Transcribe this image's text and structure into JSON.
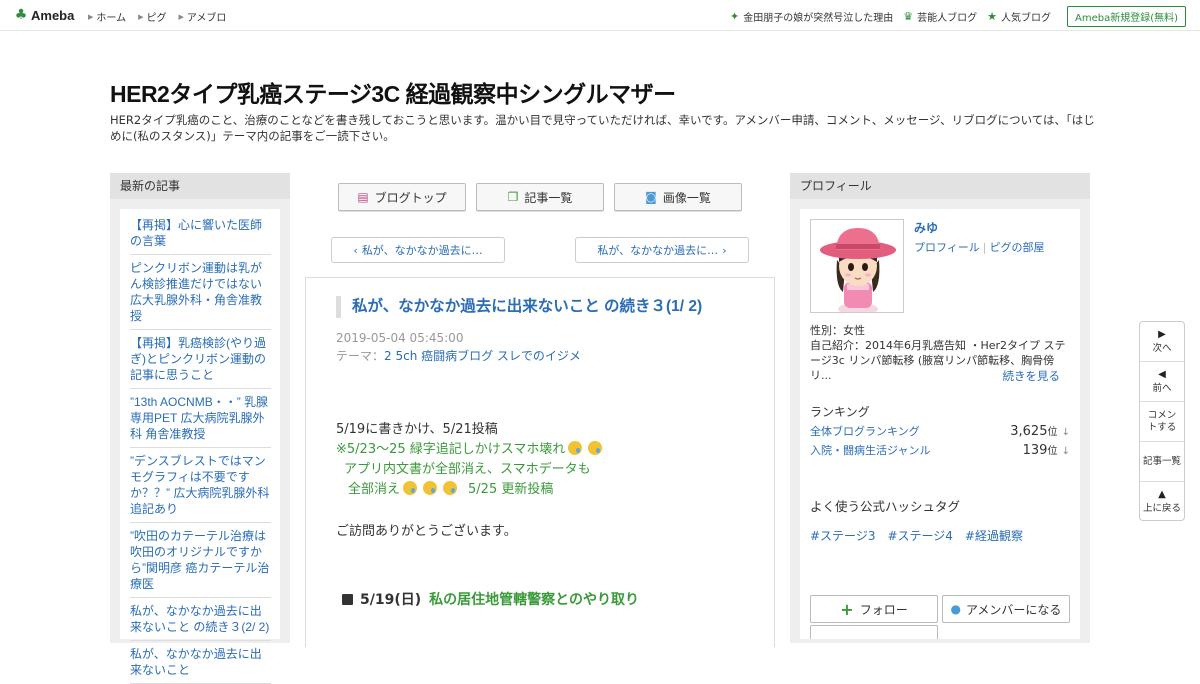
{
  "topbar": {
    "logo_text": "Ameba",
    "nav": [
      "ホーム",
      "ピグ",
      "アメブロ"
    ],
    "right_links": [
      {
        "icon": "sparkle-icon",
        "label": "金田朋子の娘が突然号泣した理由"
      },
      {
        "icon": "crown-icon",
        "label": "芸能人ブログ"
      },
      {
        "icon": "star-icon",
        "label": "人気ブログ"
      }
    ],
    "register_label": "Ameba新規登録(無料)"
  },
  "header": {
    "title": "HER2タイプ乳癌ステージ3C 経過観察中シングルマザー",
    "description": "HER2タイプ乳癌のこと、治療のことなどを書き残しておこうと思います。温かい目で見守っていただければ、幸いです。アメンバー申請、コメント、メッセージ、リブログについては、「はじめに(私のスタンス)」テーマ内の記事をご一読下さい。"
  },
  "left_sidebar": {
    "heading": "最新の記事",
    "items": [
      "【再掲】心に響いた医師の言葉",
      "ピンクリボン運動は乳がん検診推進だけではない 広大乳腺外科・角舎准教授",
      "【再掲】乳癌検診(やり過ぎ)とピンクリボン運動の記事に思うこと",
      "”13th AOCNMB・・” 乳腺専用PET 広大病院乳腺外科 角舎准教授",
      "”デンスブレストではマンモグラフィは不要ですか？？” 広大病院乳腺外科追記あり",
      "”吹田のカテーテル治療は吹田のオリジナルですから”関明彦 癌カテーテル治療医",
      "私が、なかなか過去に出来ないこと の続き３(2/ 2)",
      "私が、なかなか過去に出来ないこと"
    ]
  },
  "center": {
    "tabs": [
      {
        "icon": "document-icon",
        "label": "ブログトップ"
      },
      {
        "icon": "list-icon",
        "label": "記事一覧"
      },
      {
        "icon": "camera-icon",
        "label": "画像一覧"
      }
    ],
    "prev_label": "私が、なかなか過去に…",
    "next_label": "私が、なかなか過去に…",
    "article": {
      "title": "私が、なかなか過去に出来ないこと の続き３(1/ 2)",
      "date": "2019-05-04 05:45:00",
      "theme_prefix": "テーマ：",
      "theme_link": "2 5ch 癌闘病ブログ スレでのイジメ",
      "line1": "5/19に書きかけ、5/21投稿",
      "line2": "※5/23～25 緑字追記しかけスマホ壊れ",
      "line3": "アプリ内文書が全部消え、スマホデータも",
      "line4a": "全部消え",
      "line4b": "5/25 更新投稿",
      "line5": "ご訪問ありがとうございます。",
      "section_date": "5/19(日)",
      "section_title": "私の居住地管轄警察とのやり取り"
    }
  },
  "right_sidebar": {
    "heading": "プロフィール",
    "name": "みゆ",
    "link_profile": "プロフィール",
    "link_room": "ピグの部屋",
    "gender": "性別：女性",
    "intro": "自己紹介：2014年6月乳癌告知 ・Her2タイプ ステージ3c リンパ節転移 (腋窩リンパ節転移、胸骨傍リ...",
    "read_more": "続きを見る",
    "ranking_heading": "ランキング",
    "rankings": [
      {
        "label": "全体ブログランキング",
        "value": "3,625",
        "unit": "位"
      },
      {
        "label": "入院・闘病生活ジャンル",
        "value": "139",
        "unit": "位"
      }
    ],
    "hashtag_heading": "よく使う公式ハッシュタグ",
    "hashtags": [
      "#ステージ3",
      "#ステージ4",
      "#経過観察"
    ],
    "follow_label": "フォロー",
    "amember_label": "アメンバーになる"
  },
  "float_nav": [
    {
      "icon": "play-right-icon",
      "label": "次へ"
    },
    {
      "icon": "play-left-icon",
      "label": "前へ"
    },
    {
      "icon": "",
      "label": "コメントする"
    },
    {
      "icon": "",
      "label": "記事一覧"
    },
    {
      "icon": "triangle-up-icon",
      "label": "上に戻る"
    }
  ],
  "colors": {
    "brand_green": "#2d8c3c",
    "link_blue": "#2a6db5",
    "text_green": "#3a9a3a"
  }
}
